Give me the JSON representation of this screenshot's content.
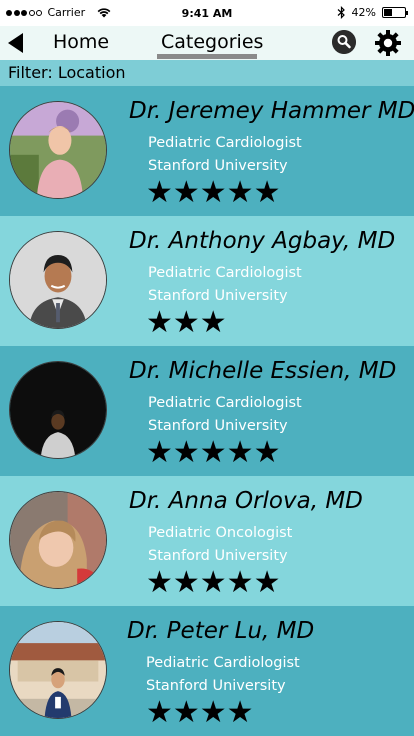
{
  "status_bar": {
    "carrier": "Carrier",
    "time": "9:41 AM",
    "battery": "42%",
    "battery_level": 0.42
  },
  "nav": {
    "home_label": "Home",
    "categories_label": "Categories"
  },
  "filter": {
    "label": "Filter: Location"
  },
  "doctors": [
    {
      "name": "Dr. Jeremey Hammer MD",
      "specialty": "Pediatric Cardiologist",
      "institution": "Stanford University",
      "rating": 5,
      "stars": "★★★★★"
    },
    {
      "name": "Dr. Anthony Agbay, MD",
      "specialty": "Pediatric Cardiologist",
      "institution": "Stanford University",
      "rating": 3,
      "stars": "★★★"
    },
    {
      "name": "Dr. Michelle Essien, MD",
      "specialty": "Pediatric Cardiologist",
      "institution": "Stanford University",
      "rating": 5,
      "stars": "★★★★★"
    },
    {
      "name": "Dr. Anna Orlova, MD",
      "specialty": "Pediatric Oncologist",
      "institution": "Stanford University",
      "rating": 5,
      "stars": "★★★★★"
    },
    {
      "name": "Dr. Peter Lu, MD",
      "specialty": "Pediatric Cardiologist",
      "institution": "Stanford University",
      "rating": 4,
      "stars": "★★★★"
    }
  ],
  "colors": {
    "row_dark": "#4db0bf",
    "row_light": "#84d6dc",
    "filter_bar": "#7ecdd6",
    "nav_bar": "#edf8f6"
  }
}
